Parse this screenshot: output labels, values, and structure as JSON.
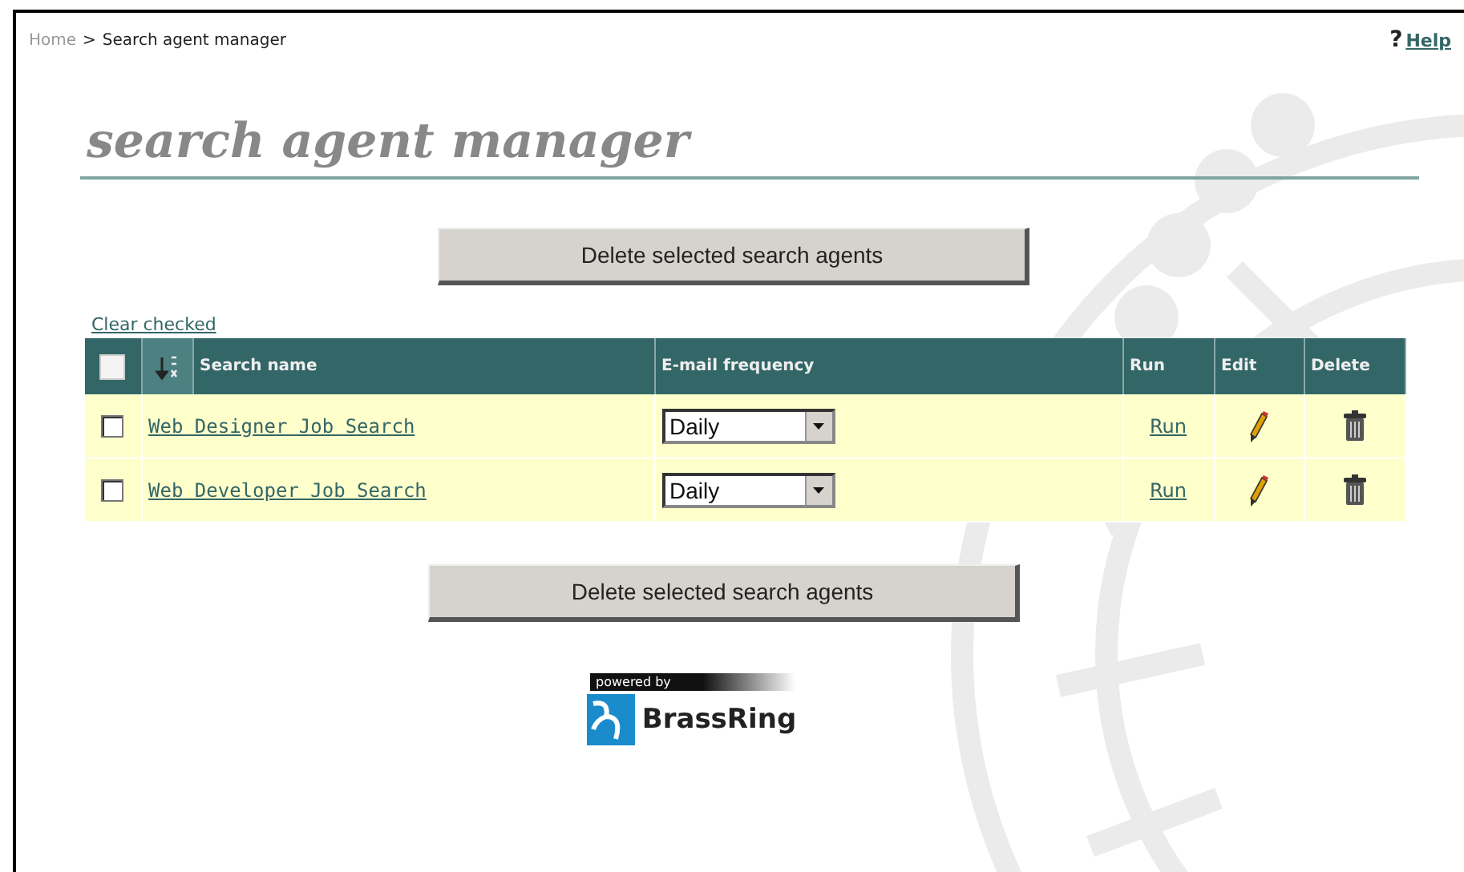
{
  "breadcrumb": {
    "home": "Home",
    "separator": ">",
    "current": "Search agent manager"
  },
  "help": {
    "icon": "?",
    "label": "Help"
  },
  "title": "search agent manager",
  "delete_button_top": "Delete selected search agents",
  "clear_checked": "Clear checked",
  "table": {
    "select_all": {
      "checked": false
    },
    "columns": [
      "Search name",
      "E-mail frequency",
      "Run",
      "Edit",
      "Delete"
    ],
    "rows": [
      {
        "checked": false,
        "name": "Web Designer Job Search",
        "frequency": "Daily",
        "run": "Run"
      },
      {
        "checked": false,
        "name": "Web Developer Job Search",
        "frequency": "Daily",
        "run": "Run"
      }
    ]
  },
  "delete_button_bottom": "Delete selected search agents",
  "footer": {
    "powered_by": "powered by",
    "brand": "BrassRing"
  }
}
